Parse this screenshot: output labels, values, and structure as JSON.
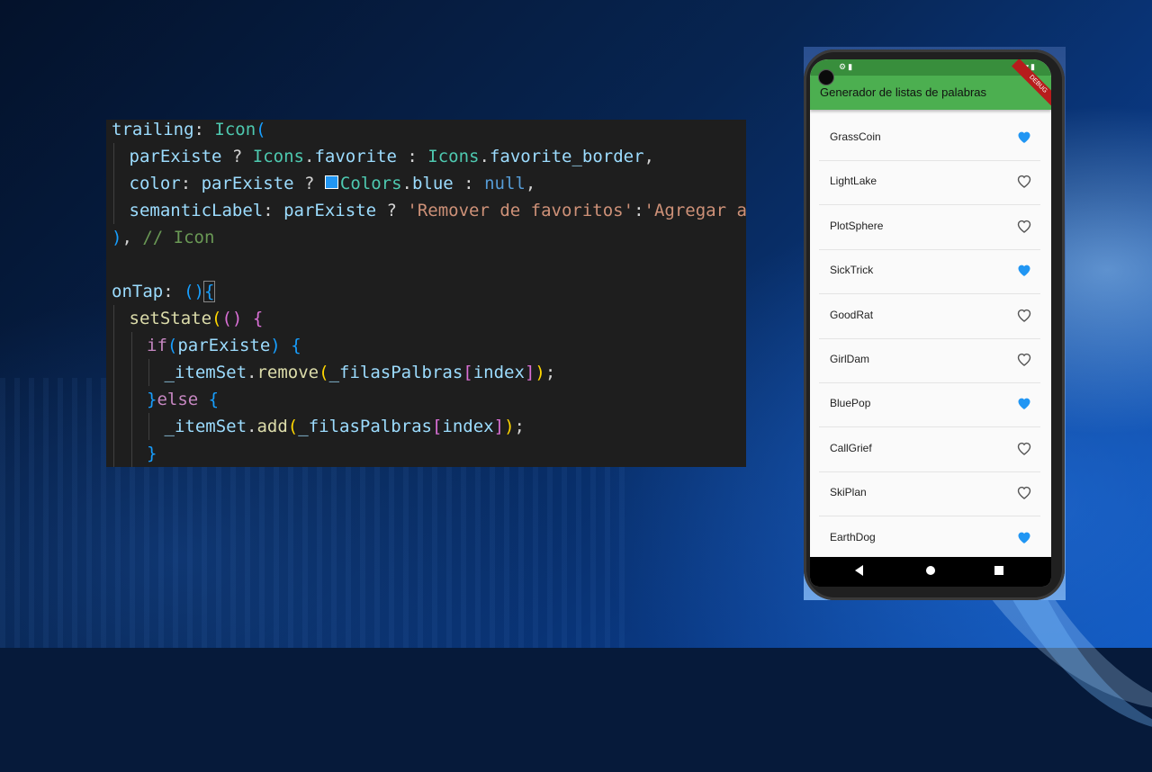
{
  "code": {
    "lines": [
      {
        "indent": 0,
        "tokens": [
          [
            "trailing",
            "prop"
          ],
          [
            ": ",
            "plain"
          ],
          [
            "Icon",
            "class"
          ],
          [
            "(",
            "p3"
          ]
        ]
      },
      {
        "indent": 1,
        "tokens": [
          [
            "parExiste",
            "prop"
          ],
          [
            " ? ",
            "plain"
          ],
          [
            "Icons",
            "class"
          ],
          [
            ".",
            "plain"
          ],
          [
            "favorite",
            "prop"
          ],
          [
            " : ",
            "plain"
          ],
          [
            "Icons",
            "class"
          ],
          [
            ".",
            "plain"
          ],
          [
            "favorite_border",
            "prop"
          ],
          [
            ",",
            "plain"
          ]
        ]
      },
      {
        "indent": 1,
        "tokens": [
          [
            "color",
            "prop"
          ],
          [
            ": ",
            "plain"
          ],
          [
            "parExiste",
            "prop"
          ],
          [
            " ? ",
            "plain"
          ],
          [
            "",
            "swatch"
          ],
          [
            "Colors",
            "class"
          ],
          [
            ".",
            "plain"
          ],
          [
            "blue",
            "prop"
          ],
          [
            " : ",
            "plain"
          ],
          [
            "null",
            "kw"
          ],
          [
            ",",
            "plain"
          ]
        ]
      },
      {
        "indent": 1,
        "tokens": [
          [
            "semanticLabel",
            "prop"
          ],
          [
            ": ",
            "plain"
          ],
          [
            "parExiste",
            "prop"
          ],
          [
            " ? ",
            "plain"
          ],
          [
            "'Remover de favoritos'",
            "str"
          ],
          [
            ":",
            "plain"
          ],
          [
            "'Agregar a favoritos'",
            "str"
          ],
          [
            ",",
            "plain"
          ]
        ]
      },
      {
        "indent": 0,
        "tokens": [
          [
            ")",
            "p3"
          ],
          [
            ", ",
            "plain"
          ],
          [
            "// Icon",
            "com"
          ]
        ]
      },
      {
        "indent": 0,
        "tokens": []
      },
      {
        "indent": 0,
        "tokens": [
          [
            "onTap",
            "prop"
          ],
          [
            ": ",
            "plain"
          ],
          [
            "()",
            "p3"
          ],
          [
            "{",
            "cursor"
          ]
        ]
      },
      {
        "indent": 1,
        "tokens": [
          [
            "setState",
            "fn"
          ],
          [
            "(",
            "p1"
          ],
          [
            "()",
            "p2"
          ],
          [
            " ",
            "plain"
          ],
          [
            "{",
            "p2"
          ]
        ]
      },
      {
        "indent": 2,
        "tokens": [
          [
            "if",
            "ctrl"
          ],
          [
            "(",
            "p3"
          ],
          [
            "parExiste",
            "prop"
          ],
          [
            ")",
            "p3"
          ],
          [
            " ",
            "plain"
          ],
          [
            "{",
            "p3"
          ]
        ]
      },
      {
        "indent": 3,
        "tokens": [
          [
            "_itemSet",
            "prop"
          ],
          [
            ".",
            "plain"
          ],
          [
            "remove",
            "fn"
          ],
          [
            "(",
            "p1"
          ],
          [
            "_filasPalbras",
            "prop"
          ],
          [
            "[",
            "p2"
          ],
          [
            "index",
            "prop"
          ],
          [
            "]",
            "p2"
          ],
          [
            ")",
            "p1"
          ],
          [
            ";",
            "plain"
          ]
        ]
      },
      {
        "indent": 2,
        "tokens": [
          [
            "}",
            "p3"
          ],
          [
            "else",
            "ctrl"
          ],
          [
            " ",
            "plain"
          ],
          [
            "{",
            "p3"
          ]
        ]
      },
      {
        "indent": 3,
        "tokens": [
          [
            "_itemSet",
            "prop"
          ],
          [
            ".",
            "plain"
          ],
          [
            "add",
            "fn"
          ],
          [
            "(",
            "p1"
          ],
          [
            "_filasPalbras",
            "prop"
          ],
          [
            "[",
            "p2"
          ],
          [
            "index",
            "prop"
          ],
          [
            "]",
            "p2"
          ],
          [
            ")",
            "p1"
          ],
          [
            ";",
            "plain"
          ]
        ]
      },
      {
        "indent": 2,
        "tokens": [
          [
            "}",
            "p3"
          ]
        ]
      }
    ]
  },
  "phone": {
    "appbar_title": "Generador de listas de palabras",
    "debug_banner": "DEBUG",
    "favorite_color": "#2196f3",
    "items": [
      {
        "label": "GrassCoin",
        "favorite": true
      },
      {
        "label": "LightLake",
        "favorite": false
      },
      {
        "label": "PlotSphere",
        "favorite": false
      },
      {
        "label": "SickTrick",
        "favorite": true
      },
      {
        "label": "GoodRat",
        "favorite": false
      },
      {
        "label": "GirlDam",
        "favorite": false
      },
      {
        "label": "BluePop",
        "favorite": true
      },
      {
        "label": "CallGrief",
        "favorite": false
      },
      {
        "label": "SkiPlan",
        "favorite": false
      },
      {
        "label": "EarthDog",
        "favorite": true
      }
    ]
  }
}
